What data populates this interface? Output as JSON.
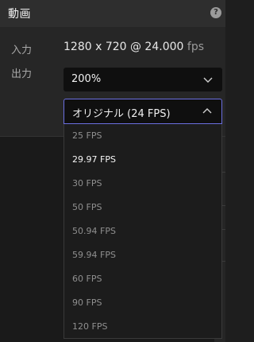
{
  "header": {
    "title": "動画",
    "help_icon": "help-circle-icon"
  },
  "input": {
    "label": "入力",
    "resolution": "1280 x 720 @ 24.000",
    "fps_unit": "fps"
  },
  "output": {
    "label": "出力",
    "scale_select": {
      "value": "200%",
      "icon": "chevron-down-icon"
    },
    "framerate_select": {
      "value": "オリジナル (24 FPS)",
      "icon": "chevron-up-icon",
      "open": true,
      "options": [
        "25 FPS",
        "29.97 FPS",
        "30 FPS",
        "50 FPS",
        "50.94 FPS",
        "59.94 FPS",
        "60 FPS",
        "90 FPS",
        "120 FPS"
      ],
      "highlighted_option": "29.97 FPS"
    }
  },
  "colors": {
    "accent_border": "#6b6fe0",
    "panel_bg": "#262626",
    "field_bg": "#0f0f0f"
  }
}
